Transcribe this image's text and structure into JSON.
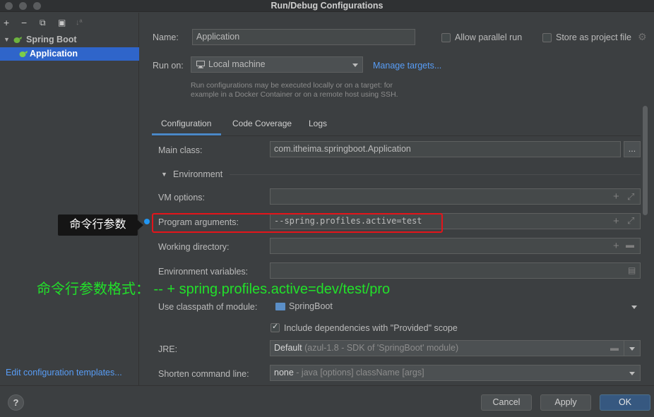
{
  "window": {
    "title": "Run/Debug Configurations"
  },
  "toolbar": {
    "add": "+",
    "remove": "−",
    "copy": "⧉",
    "folder": "▣",
    "sort": "↓ª"
  },
  "tree": {
    "group_label": "Spring Boot",
    "selected_label": "Application"
  },
  "left_footer": {
    "edit_templates": "Edit configuration templates..."
  },
  "config": {
    "name_label": "Name:",
    "name_value": "Application",
    "allow_parallel": "Allow parallel run",
    "store_project": "Store as project file",
    "run_on_label": "Run on:",
    "run_on_value": "Local machine",
    "manage_targets": "Manage targets...",
    "run_on_hint_1": "Run configurations may be executed locally or on a target: for",
    "run_on_hint_2": "example in a Docker Container or on a remote host using SSH."
  },
  "tabs": {
    "configuration": "Configuration",
    "coverage": "Code Coverage",
    "logs": "Logs"
  },
  "form": {
    "main_class_label": "Main class:",
    "main_class_value": "com.itheima.springboot.Application",
    "browse": "...",
    "environment_header": "Environment",
    "vm_options_label": "VM options:",
    "program_args_label": "Program arguments:",
    "program_args_value": "--spring.profiles.active=test",
    "working_dir_label": "Working directory:",
    "env_vars_label": "Environment variables:",
    "classpath_label": "Use classpath of module:",
    "classpath_value": "SpringBoot",
    "include_deps": "Include dependencies with \"Provided\" scope",
    "jre_label": "JRE:",
    "jre_value_bold": "Default",
    "jre_value_rest": " (azul-1.8 - SDK of 'SpringBoot' module)",
    "shorten_label": "Shorten command line:",
    "shorten_value_bold": "none",
    "shorten_value_rest": " - java [options] className [args]"
  },
  "annotations": {
    "callout": "命令行参数",
    "green_note": "命令行参数格式： -- + spring.profiles.active=dev/test/pro"
  },
  "buttons": {
    "help": "?",
    "cancel": "Cancel",
    "apply": "Apply",
    "ok": "OK"
  },
  "colors": {
    "accent": "#2f65ca",
    "link": "#589df6",
    "highlight": "#e4141a",
    "note": "#22e02a",
    "ok_button": "#365880"
  }
}
